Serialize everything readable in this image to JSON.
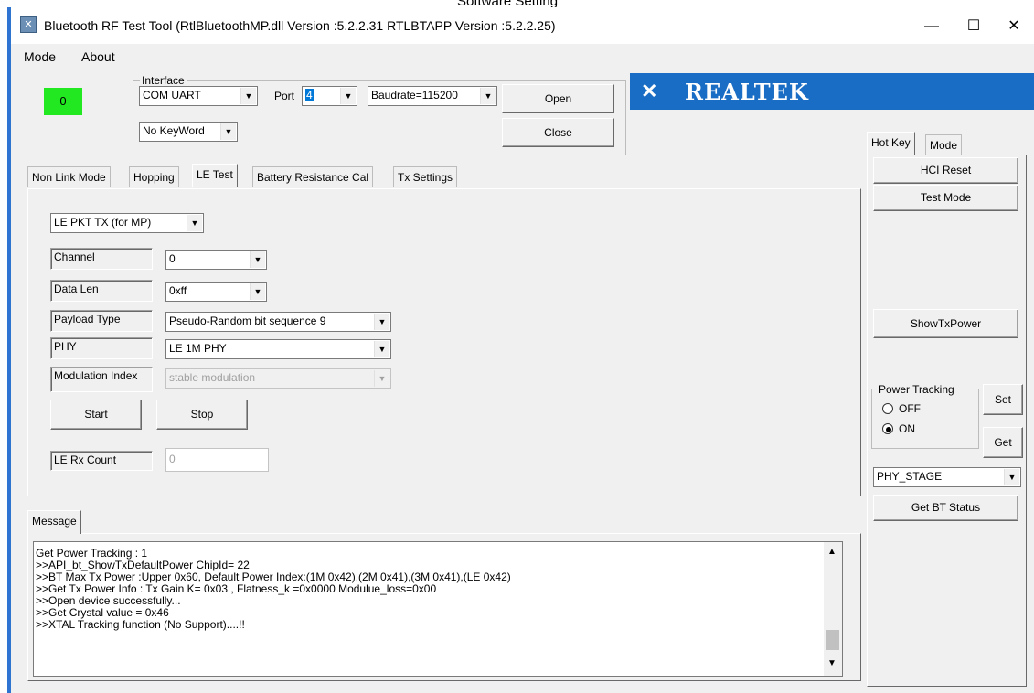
{
  "caption": "Software Setting",
  "window": {
    "title": "Bluetooth RF Test Tool (RtlBluetoothMP.dll Version :5.2.2.31   RTLBTAPP Version :5.2.2.25)",
    "minimize": "—",
    "maximize": "☐",
    "close": "✕"
  },
  "menu": {
    "mode": "Mode",
    "about": "About"
  },
  "status_indicator": {
    "value": "0",
    "color": "#22e822"
  },
  "interface": {
    "label": "Interface",
    "connection": "COM UART",
    "port_label": "Port",
    "port_value": "4",
    "baudrate": "Baudrate=115200",
    "open": "Open",
    "close": "Close",
    "keyword": "No KeyWord"
  },
  "logo": {
    "text": "REALTEK",
    "bg": "#1a6dc4"
  },
  "main_tabs": [
    "Non Link Mode",
    "Hopping",
    "LE Test",
    "Battery Resistance Cal",
    "Tx Settings"
  ],
  "le_test": {
    "mode_select": "LE PKT TX (for MP)",
    "channel_label": "Channel",
    "channel_value": "0",
    "datalen_label": "Data Len",
    "datalen_value": "0xff",
    "payload_label": "Payload Type",
    "payload_value": "Pseudo-Random bit sequence 9",
    "phy_label": "PHY",
    "phy_value": "LE 1M PHY",
    "modidx_label": "Modulation Index",
    "modidx_value": "stable modulation",
    "start": "Start",
    "stop": "Stop",
    "rx_count_label": "LE Rx Count",
    "rx_count_value": "0"
  },
  "message": {
    "tab": "Message",
    "lines": [
      "Get Power Tracking : 1",
      ">>API_bt_ShowTxDefaultPower  ChipId= 22",
      ">>BT Max Tx Power :Upper 0x60,  Default Power Index:(1M 0x42),(2M 0x41),(3M 0x41),(LE 0x42)",
      ">>Get Tx Power Info : Tx Gain K= 0x03 , Flatness_k =0x0000 Modulue_loss=0x00",
      ">>Open device successfully...",
      ">>Get Crystal value = 0x46",
      ">>XTAL Tracking function (No Support)....!!"
    ]
  },
  "right_panel": {
    "tabs": [
      "Hot Key",
      "Mode"
    ],
    "hci_reset": "HCI Reset",
    "test_mode": "Test Mode",
    "show_tx_power": "ShowTxPower",
    "power_tracking_label": "Power Tracking",
    "off": "OFF",
    "on": "ON",
    "power_tracking_selected": "ON",
    "set": "Set",
    "get": "Get",
    "status_select": "PHY_STAGE",
    "get_bt_status": "Get BT Status"
  }
}
